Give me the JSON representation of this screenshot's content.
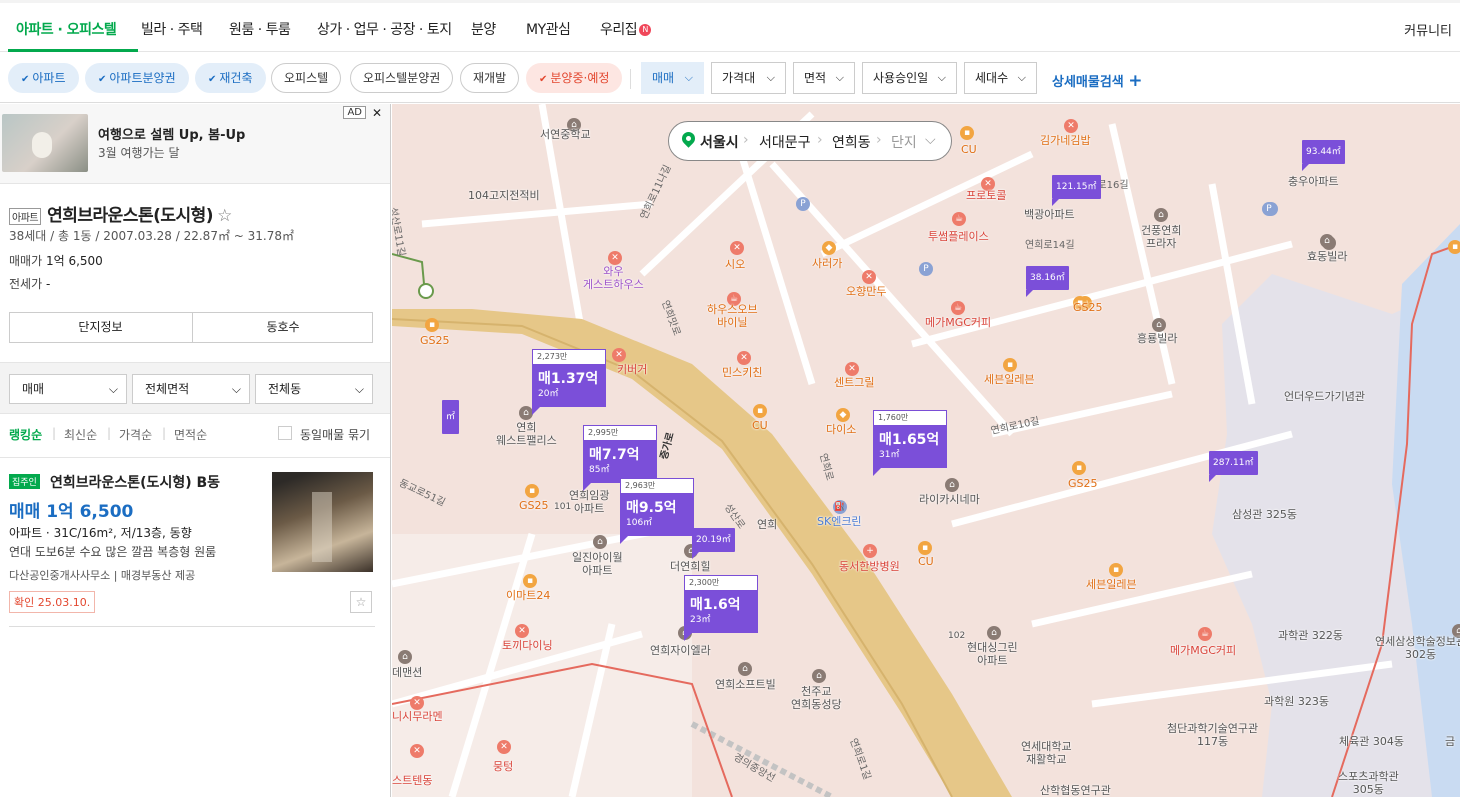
{
  "nav": {
    "tabs": [
      "아파트 · 오피스텔",
      "빌라 · 주택",
      "원룸 · 투룸",
      "상가 · 업무 · 공장 · 토지",
      "분양",
      "MY관심",
      "우리집"
    ],
    "badge": "N",
    "community": "커뮤니티"
  },
  "filters": {
    "chips": [
      "아파트",
      "아파트분양권",
      "재건축",
      "오피스텔",
      "오피스텔분양권",
      "재개발",
      "분양중·예정"
    ],
    "dropdowns": [
      "매매",
      "가격대",
      "면적",
      "사용승인일",
      "세대수"
    ],
    "detail_search": "상세매물검색",
    "detail_plus": "+"
  },
  "ad": {
    "title": "여행으로 설렘 Up, 봄-Up",
    "subtitle": "3월 여행가는 달",
    "tag": "AD",
    "close": "✕"
  },
  "property": {
    "type": "아파트",
    "name": "연희브라운스톤(도시형)",
    "star": "☆",
    "meta": "38세대 / 총 1동 / 2007.03.28 / 22.87㎡ ~ 31.78㎡",
    "sale_label": "매매가",
    "sale_value": "1억 6,500",
    "jeonse_label": "전세가",
    "jeonse_value": "-",
    "tab_info": "단지정보",
    "tab_unit": "동호수"
  },
  "selects": [
    "매매",
    "전체면적",
    "전체동"
  ],
  "sort": {
    "options": [
      "랭킹순",
      "최신순",
      "가격순",
      "면적순"
    ],
    "same_listing": "동일매물 묶기"
  },
  "listing": {
    "badge": "집주인",
    "title": "연희브라운스톤(도시형) B동",
    "price": "매매 1억 6,500",
    "desc": "아파트 · 31C/16m², 저/13층, 동향",
    "desc2": "연대 도보6분 수요 많은 깔끔 복층형 원룸",
    "source": "다산공인중개사사무소 | 매경부동산 제공",
    "confirm": "확인 25.03.10.",
    "star": "☆"
  },
  "map": {
    "breadcrumb": [
      "서울시",
      "서대문구",
      "연희동",
      "단지"
    ],
    "markers": [
      {
        "top": "2,273만",
        "price": "매1.37억",
        "area": "20㎡"
      },
      {
        "top": "2,995만",
        "price": "매7.7억",
        "area": "85㎡"
      },
      {
        "top": "2,963만",
        "price": "매9.5억",
        "area": "106㎡"
      },
      {
        "top": "2,300만",
        "price": "매1.6억",
        "area": "23㎡"
      },
      {
        "top": "1,760만",
        "price": "매1.65억",
        "area": "31㎡"
      }
    ],
    "small_markers": [
      "93.44㎡",
      "121.15㎡",
      "38.16㎡",
      "287.11㎡",
      "20.19㎡",
      "㎡"
    ],
    "labels": {
      "seoyeon": "서연중학교",
      "memorial": "104고지전적비",
      "wau": "와우\n게스트하우스",
      "sio": "시오",
      "sarada": "사러가",
      "ohyang": "오향만두",
      "hiuse": "하우스오브\n바이닐",
      "minsu": "민스키친",
      "center": "센트그릴",
      "kimga": "김가네김밥",
      "proto": "프로토콜",
      "baekgwang": "백광아파트",
      "twosome": "투썸플레이스",
      "mega1": "메가MGC커피",
      "sebun1": "세븐일레븐",
      "cu1": "CU",
      "gs1": "GS25",
      "chungwoo": "충우아파트",
      "gunpung": "건풍연희\n프라자",
      "hyodong": "효동빌라",
      "gs2": "GS25",
      "heungryung": "흥룡빌라",
      "underwood": "언더우드가기념관",
      "yeonhui_west": "연희\n웨스트팰리스",
      "gs3": "GS25",
      "gs4": "GS25",
      "cu2": "CU",
      "daiso": "다이소",
      "yeonhui_imgwang": "연희임광\n아파트",
      "lakaisinema": "라이카시네마",
      "gs5": "GS25",
      "samsung325": "삼성관 325동",
      "iljin": "일진아이월\n아파트",
      "sk": "SK엔크린",
      "dongseo": "동서한방병원",
      "cu3": "CU",
      "sebun2": "세븐일레븐",
      "emart": "이마트24",
      "tokki": "토끼다이닝",
      "deoyeonhui": "더연희힐",
      "yeonhuija": "연희자이엘라",
      "hyundai": "현대싱그린\n아파트",
      "mega2": "메가MGC커피",
      "science322": "과학관 322동",
      "yeonse_sam": "연세삼성학술정보관\n302동",
      "science323": "과학원 323동",
      "yeonhui_soft": "연희소프트빌",
      "cheonju": "천주교\n연희동성당",
      "cheomdan": "첨단과학기술연구관\n117동",
      "yonsei_rehab": "연세대학교\n재활학교",
      "sports": "스포츠과학관\n305동",
      "sanhak": "산학협동연구관",
      "physical": "체육관 304동",
      "geum": "금",
      "demansion": "데맨션",
      "nishimura": "니시무라멘",
      "moongteong": "뭉텅",
      "stendo": "스트텐동",
      "jiburger": "키버거",
      "ic": "연희",
      "num101": "101",
      "num102": "102",
      "gs_left": "GS25"
    },
    "roads": [
      "연희로11나길",
      "연희로14길",
      "연희로16길",
      "연희로10길",
      "연희로",
      "성산로",
      "증가로",
      "동교로51길",
      "성산로11길",
      "연희맛로",
      "연희로1길",
      "경의중앙선"
    ]
  },
  "colors": {
    "accent": "#03a94d",
    "marker": "#7b4fd9",
    "link": "#1b6dc2"
  }
}
